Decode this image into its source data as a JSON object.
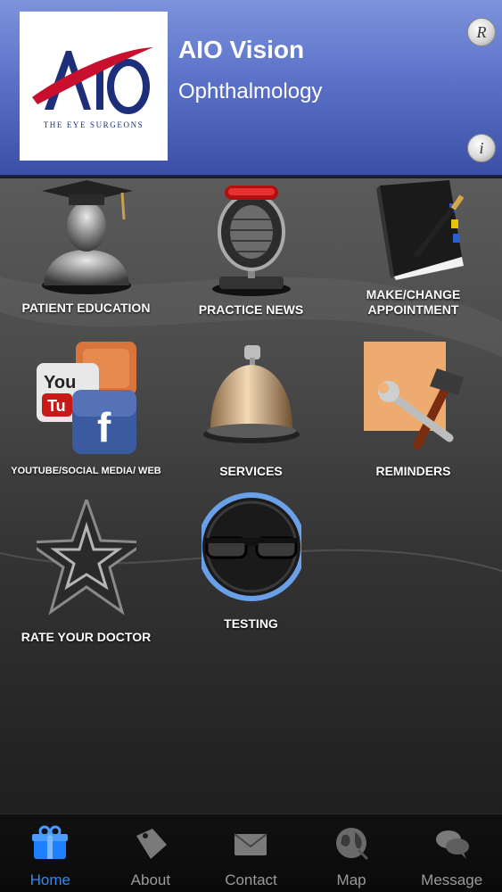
{
  "header": {
    "logo_text": "THE EYE SURGEONS",
    "title": "AIO Vision",
    "subtitle": "Ophthalmology",
    "top_button_glyph": "R",
    "bottom_button_glyph": "i"
  },
  "tiles": [
    {
      "label": "PATIENT EDUCATION",
      "icon": "graduate-icon"
    },
    {
      "label": "PRACTICE NEWS",
      "icon": "microphone-icon"
    },
    {
      "label": "MAKE/CHANGE APPOINTMENT",
      "icon": "appointment-book-icon"
    },
    {
      "label": "YOUTUBE/SOCIAL MEDIA/ WEB",
      "icon": "social-media-icon"
    },
    {
      "label": "SERVICES",
      "icon": "service-bell-icon"
    },
    {
      "label": "REMINDERS",
      "icon": "tools-icon"
    },
    {
      "label": "RATE YOUR DOCTOR",
      "icon": "star-icon"
    },
    {
      "label": "TESTING",
      "icon": "glasses-icon"
    }
  ],
  "tabbar": {
    "items": [
      {
        "label": "Home",
        "icon": "gift-icon",
        "active": true
      },
      {
        "label": "About",
        "icon": "tag-icon",
        "active": false
      },
      {
        "label": "Contact",
        "icon": "envelope-icon",
        "active": false
      },
      {
        "label": "Map",
        "icon": "globe-icon",
        "active": false
      },
      {
        "label": "Message",
        "icon": "chat-bubble-icon",
        "active": false
      }
    ]
  },
  "colors": {
    "header_top": "#7d93dc",
    "header_bottom": "#3b4fa6",
    "active_tab": "#2a8cff",
    "inactive_tab": "#9a9a9a",
    "logo_blue": "#1d2f7a",
    "logo_red": "#c8102e"
  }
}
